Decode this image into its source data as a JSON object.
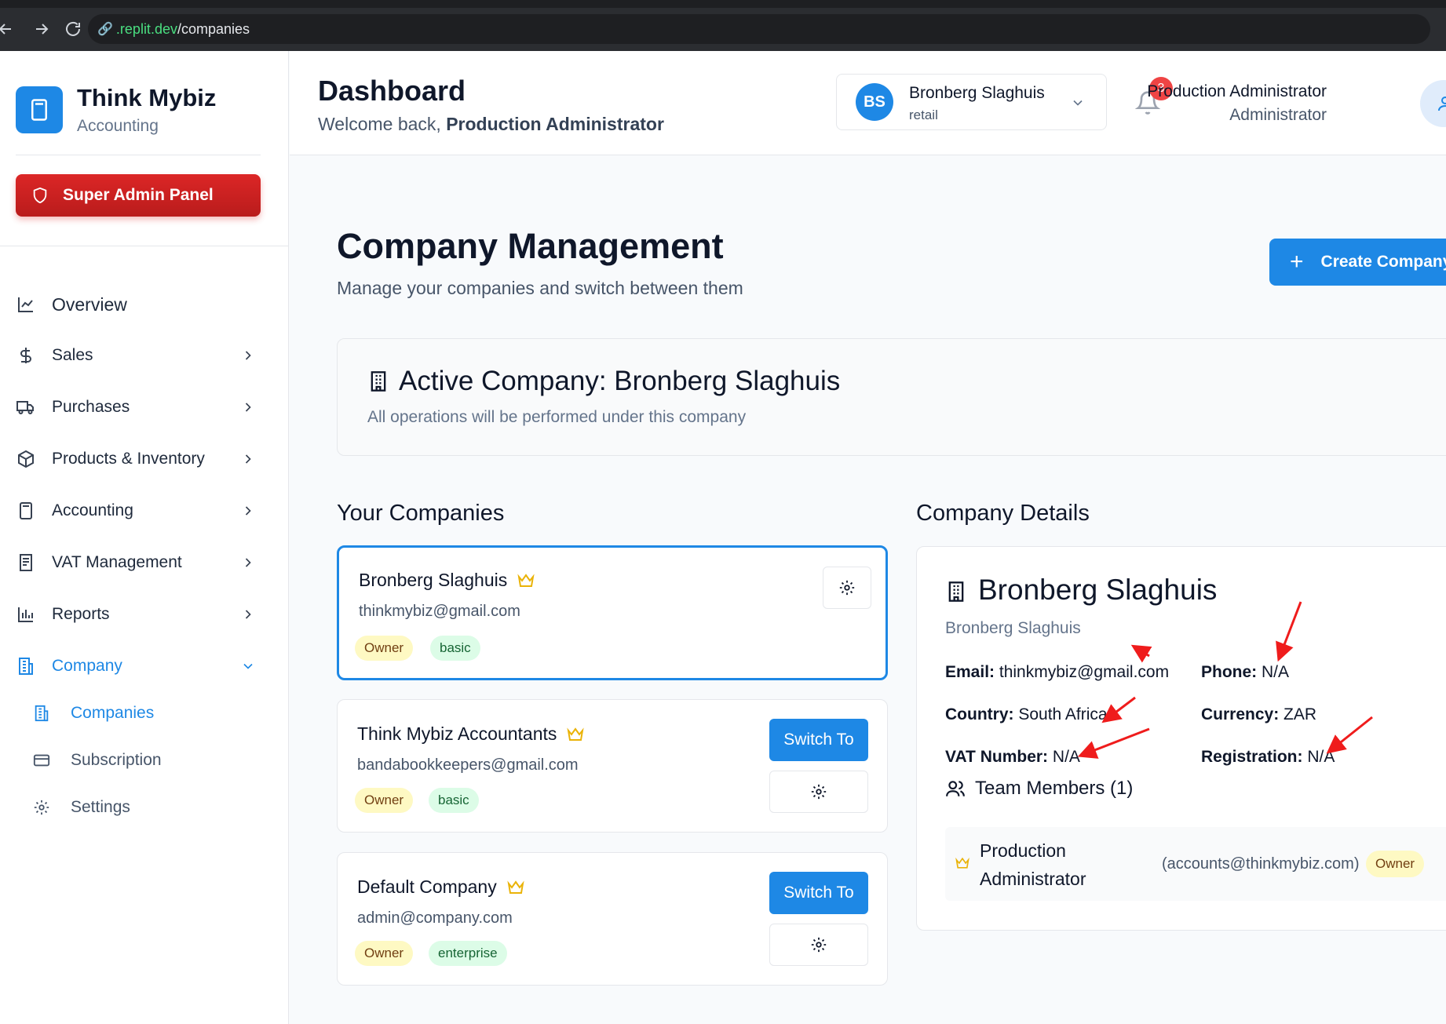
{
  "browser": {
    "url_host": ".replit.dev",
    "url_path": "/companies"
  },
  "sidebar": {
    "brand_title": "Think Mybiz",
    "brand_subtitle": "Accounting",
    "admin_button": "Super Admin Panel",
    "items": [
      {
        "label": "Overview",
        "icon": "chart-line-icon"
      },
      {
        "label": "Sales",
        "icon": "dollar-icon"
      },
      {
        "label": "Purchases",
        "icon": "truck-icon"
      },
      {
        "label": "Products & Inventory",
        "icon": "box-icon"
      },
      {
        "label": "Accounting",
        "icon": "calculator-icon"
      },
      {
        "label": "VAT Management",
        "icon": "receipt-icon"
      },
      {
        "label": "Reports",
        "icon": "bar-chart-icon"
      },
      {
        "label": "Company",
        "icon": "building-icon"
      }
    ],
    "company_sub": [
      {
        "label": "Companies",
        "icon": "building-icon"
      },
      {
        "label": "Subscription",
        "icon": "credit-card-icon"
      },
      {
        "label": "Settings",
        "icon": "gear-icon"
      }
    ]
  },
  "header": {
    "title": "Dashboard",
    "welcome_prefix": "Welcome back, ",
    "welcome_name": "Production Administrator",
    "company_initials": "BS",
    "company_name": "Bronberg Slaghuis",
    "company_type": "retail",
    "notification_count": "3",
    "user_name": "Production Administrator",
    "user_role": "Administrator"
  },
  "main": {
    "title": "Company Management",
    "subtitle": "Manage your companies and switch between them",
    "create_button": "Create Company",
    "active_title": "Active Company: Bronberg Slaghuis",
    "active_subtitle": "All operations will be performed under this company",
    "your_companies_title": "Your Companies",
    "details_title": "Company Details",
    "switch_label": "Switch To",
    "companies": [
      {
        "name": "Bronberg Slaghuis",
        "email": "thinkmybiz@gmail.com",
        "role": "Owner",
        "plan": "basic"
      },
      {
        "name": "Think Mybiz Accountants",
        "email": "bandabookkeepers@gmail.com",
        "role": "Owner",
        "plan": "basic"
      },
      {
        "name": "Default Company",
        "email": "admin@company.com",
        "role": "Owner",
        "plan": "enterprise"
      }
    ]
  },
  "details": {
    "name": "Bronberg Slaghuis",
    "subname": "Bronberg Slaghuis",
    "email_label": "Email:",
    "email": "thinkmybiz@gmail.com",
    "phone_label": "Phone:",
    "phone": "N/A",
    "country_label": "Country:",
    "country": "South Africa",
    "currency_label": "Currency:",
    "currency": "ZAR",
    "vat_label": "VAT Number:",
    "vat": "N/A",
    "registration_label": "Registration:",
    "registration": "N/A",
    "team_title": "Team Members (1)",
    "member_name": "Production Administrator",
    "member_email": "(accounts@thinkmybiz.com)",
    "member_role": "Owner"
  },
  "colors": {
    "accent": "#1e88e5",
    "danger": "#dc2626",
    "annotation_arrow": "#ef1c1c"
  }
}
